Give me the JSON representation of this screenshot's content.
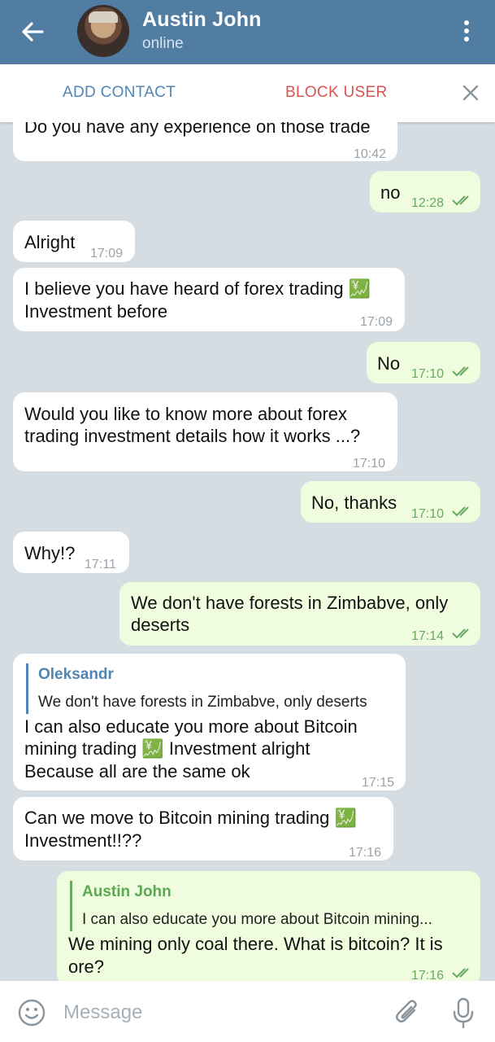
{
  "header": {
    "title": "Austin John",
    "status": "online",
    "colors": {
      "bar": "#527da3"
    }
  },
  "actions": {
    "add_contact": "ADD CONTACT",
    "block_user": "BLOCK USER"
  },
  "messages": [
    {
      "dir": "in",
      "text": "Do you have any experience on those trade",
      "time": "10:42"
    },
    {
      "dir": "out",
      "text": "no",
      "time": "12:28"
    },
    {
      "dir": "in",
      "text": "Alright",
      "time": "17:09"
    },
    {
      "dir": "in",
      "text_line1": "I believe you have heard of forex trading",
      "text_line2": "Investment before",
      "emoji": "💹",
      "time": "17:09"
    },
    {
      "dir": "out",
      "text": "No",
      "time": "17:10"
    },
    {
      "dir": "in",
      "text_line1": "Would you like to know more about forex",
      "text_line2": "trading investment details how it works ...?",
      "time": "17:10"
    },
    {
      "dir": "out",
      "text": "No, thanks",
      "time": "17:10"
    },
    {
      "dir": "in",
      "text": "Why!?",
      "time": "17:11"
    },
    {
      "dir": "out",
      "text_line1": "We don't have forests in Zimbabve, only",
      "text_line2": "deserts",
      "time": "17:14"
    },
    {
      "dir": "in",
      "quote_name": "Oleksandr",
      "quote_text": "We don't have forests in Zimbabve, only deserts",
      "text_line1": "I can also educate you more about Bitcoin",
      "text_line2a": "mining trading",
      "emoji": "💹",
      "text_line2b": "Investment alright",
      "text_line3": "Because all are the same ok",
      "time": "17:15"
    },
    {
      "dir": "in",
      "text_line1a": "Can we move to Bitcoin mining trading",
      "emoji": "💹",
      "text_line2": "Investment!!??",
      "time": "17:16"
    },
    {
      "dir": "out",
      "quote_name": "Austin John",
      "quote_text": "I can also educate you more about Bitcoin mining...",
      "text_line1": "We mining only coal there. What is bitcoin? It is",
      "text_line2": "ore?",
      "time": "17:16"
    }
  ],
  "input": {
    "placeholder": "Message"
  },
  "colors": {
    "outgoing": "#effdde",
    "incoming": "#ffffff",
    "background": "#d5dde3",
    "block": "#d9534f",
    "link": "#4f86b5"
  }
}
